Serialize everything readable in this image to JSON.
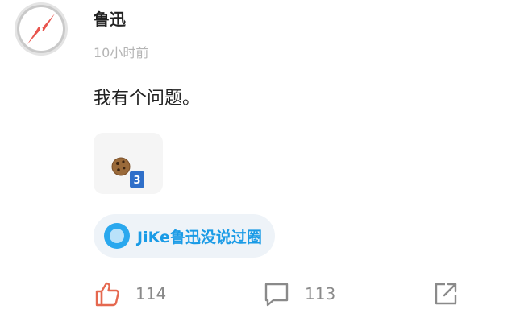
{
  "post": {
    "author": "鲁迅",
    "time": "10小时前",
    "content": "我有个问题。",
    "image": {
      "badge": "3"
    },
    "topic": {
      "label": "JiKe鲁迅没说过圈"
    },
    "actions": {
      "like_count": "114",
      "comment_count": "113"
    }
  },
  "colors": {
    "like_icon": "#e5684f",
    "topic_text": "#1a9be6",
    "topic_icon": "#2aa8ee",
    "compass_needle": "#e8554e"
  },
  "icons": {
    "avatar": "compass-icon",
    "like": "thumbs-up-icon",
    "comment": "comment-icon",
    "share": "share-icon",
    "topic": "topic-circle-icon",
    "image": "cookie-image"
  }
}
